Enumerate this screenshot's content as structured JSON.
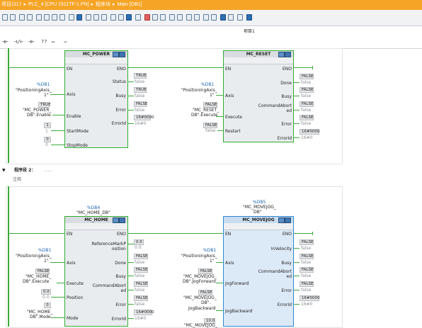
{
  "breadcrumb": {
    "items": [
      "项目1117",
      "PLC_4 [CPU 1511TF-1 PN]",
      "程序块",
      "Main [OB1]"
    ],
    "sep": "▸"
  },
  "toolbar": {
    "view_label": "项目1"
  },
  "fbd_toolbar": {
    "items": [
      "⊣⊢",
      "⊣/⊢",
      "⊣⊢",
      "??",
      "↦",
      "⇀"
    ]
  },
  "network2": {
    "label": "程序段 2：",
    "dots": "......",
    "comment": "注释"
  },
  "blocks": {
    "power": {
      "name": "MC_POWER",
      "in_pins": [
        "EN",
        "Axis",
        "Enable",
        "StartMode",
        "StopMode"
      ],
      "out_pins": [
        "ENO",
        "Status",
        "Busy",
        "Error",
        "ErrorId"
      ],
      "axis_db": "%DB1",
      "axis_name_a": "\"PositioningAxis_",
      "axis_name_b": "1\"",
      "enable_val": "TRUE",
      "enable_tag_a": "\"MC_POWER_",
      "enable_tag_b": "DB\".Enable",
      "startmode_val": "1",
      "stopmode_val": "0",
      "status_val": "TRUE",
      "status_tag": "false",
      "busy_val": "TRUE",
      "busy_tag": "false",
      "error_val": "FALSE",
      "error_tag": "false",
      "errorid_val": "16#0000",
      "errorid_tag": "16#0"
    },
    "reset": {
      "name": "MC_RESET",
      "in_pins": [
        "EN",
        "Axis",
        "Execute",
        "Restart"
      ],
      "out_pins": [
        "ENO",
        "Done",
        "Busy",
        "CommandAbort",
        "ed",
        "Error",
        "ErrorId"
      ],
      "axis_db": "%DB1",
      "axis_name_a": "\"PositioningAxis_",
      "axis_name_b": "1\"",
      "execute_val": "FALSE",
      "execute_tag_a": "\"MC_RESET_",
      "execute_tag_b": "DB\".Execute",
      "restart_val": "FALSE",
      "restart_tag": "false",
      "done_val": "FALSE",
      "done_tag": "false",
      "busy_val": "FALSE",
      "busy_tag": "false",
      "cmd_val": "FALSE",
      "cmd_tag": "false",
      "error_val": "FALSE",
      "error_tag": "false",
      "errorid_val": "16#0000",
      "errorid_tag": "16#0"
    },
    "home": {
      "db": "%DB4",
      "db_name": "\"MC_HOME_DB\"",
      "name": "MC_HOME",
      "in_pins": [
        "EN",
        "Axis",
        "Execute",
        "Position",
        "Mode"
      ],
      "out_pins": [
        "ENO",
        "ReferenceMarkP",
        "osition",
        "Done",
        "Busy",
        "CommandAbort",
        "ed",
        "Error",
        "ErrorId"
      ],
      "axis_db": "%DB1",
      "axis_name_a": "\"PositioningAxis_",
      "axis_name_b": "1\"",
      "execute_val": "FALSE",
      "execute_tag_a": "\"MC_HOME_",
      "execute_tag_b": "DB\".Execute",
      "position_val": "0.0",
      "position_tag": "0.0",
      "mode_val": "0",
      "mode_tag_a": "\"MC_HOME_",
      "mode_tag_b": "DB\".Mode",
      "refmark_val": "0.0",
      "refmark_tag": "0.0",
      "done_val": "FALSE",
      "done_tag": "false",
      "busy_val": "FALSE",
      "busy_tag": "false",
      "cmd_val": "FALSE",
      "cmd_tag": "false",
      "error_val": "FALSE",
      "error_tag": "false",
      "errorid_val": "16#0000",
      "errorid_tag": "16#0"
    },
    "movejog": {
      "db": "%DB5",
      "db_name_a": "\"MC_MOVEJOG_",
      "db_name_b": "DB\"",
      "name": "MC_MOVEJOG",
      "in_pins": [
        "EN",
        "Axis",
        "JogForward",
        "JogBackward"
      ],
      "out_pins": [
        "ENO",
        "InVelocity",
        "Busy",
        "CommandAbort",
        "ed",
        "Error",
        "ErrorId"
      ],
      "axis_db": "%DB1",
      "axis_name_a": "\"PositioningAxis_",
      "axis_name_b": "1\"",
      "fwd_val": "FALSE",
      "fwd_tag_a": "\"MC_MOVEJOG_",
      "fwd_tag_b": "DB\".JogForward",
      "bwd_val": "FALSE",
      "bwd_tag_a": "\"MC_MOVEJOG_",
      "bwd_tag_b": "DB\".",
      "bwd_tag_c": "JogBackward",
      "vel_val": "10.0",
      "vel_tag": "\"MC_MOVEJOG_",
      "invel_val": "FALSE",
      "invel_tag": "false",
      "busy_val": "FALSE",
      "busy_tag": "false",
      "cmd_val": "FALSE",
      "cmd_tag": "false",
      "error_val": "FALSE",
      "error_tag": "false",
      "errorid_val": "16#0000",
      "errorid_tag": "16#0"
    }
  }
}
